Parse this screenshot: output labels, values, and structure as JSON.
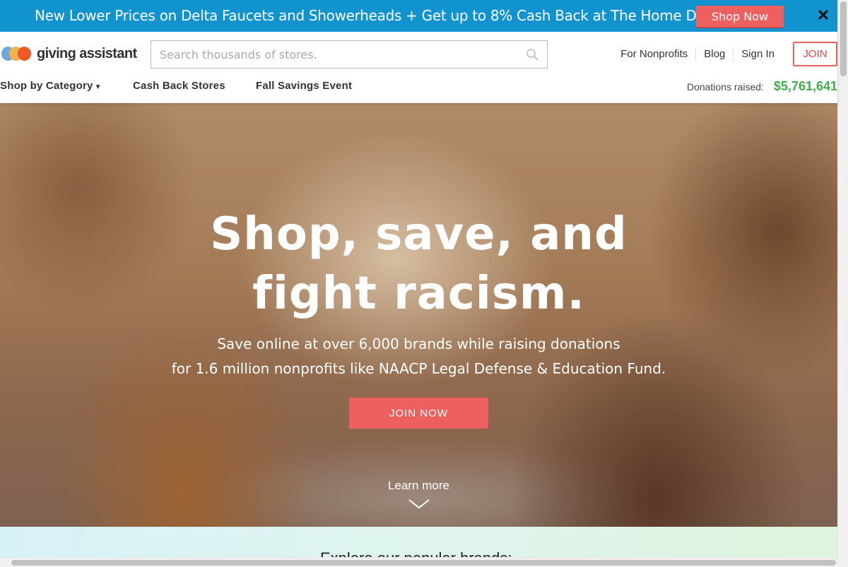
{
  "promo": {
    "text": "New Lower Prices on Delta Faucets and Showerheads + Get up to 8% Cash Back at The Home Depot",
    "button": "Shop Now",
    "close": "✕"
  },
  "header": {
    "logo_text": "giving assistant",
    "search_placeholder": "Search thousands of stores.",
    "links": [
      "For Nonprofits",
      "Blog",
      "Sign In"
    ],
    "join": "JOIN",
    "nav": {
      "category": "Shop by Category",
      "cash_back": "Cash Back Stores",
      "event": "Fall Savings Event"
    },
    "donations_label": "Donations raised:",
    "donations_value": "$5,761,641"
  },
  "hero": {
    "title_line1": "Shop, save, and",
    "title_line2": "fight racism.",
    "subtitle_line1": "Save online at over 6,000 brands while raising donations",
    "subtitle_line2": "for 1.6 million nonprofits like NAACP Legal Defense & Education Fund.",
    "cta": "JOIN NOW",
    "learn_more": "Learn more"
  },
  "brands": {
    "title": "Explore our popular brands:"
  },
  "colors": {
    "promo_bg": "#1193d0",
    "accent": "#ee5f5f",
    "donation_green": "#3fae49"
  }
}
